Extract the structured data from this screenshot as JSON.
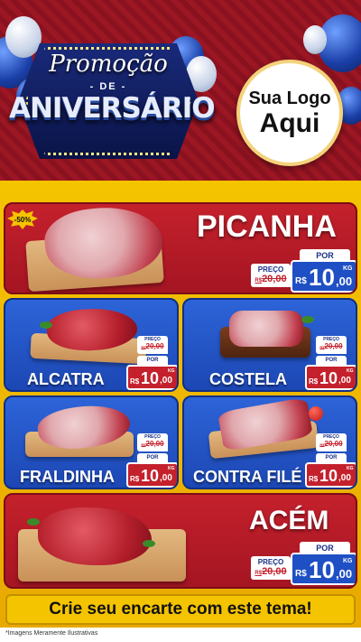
{
  "header": {
    "promo_text": "Promoção",
    "de_text": "- DE -",
    "aniversario_text": "ANIVERSÁRIO",
    "logo_line1": "Sua Logo",
    "logo_line2": "Aqui"
  },
  "products": [
    {
      "name": "PICANHA",
      "discount": "-50%",
      "preco_label": "PREÇO",
      "old_price": "R$20,00",
      "old_currency": "R$",
      "old_value": "20,00",
      "por_label": "POR",
      "currency": "R$",
      "price_int": "10",
      "price_cents": ",00",
      "unit": "KG"
    },
    {
      "name": "ALCATRA",
      "preco_label": "PREÇO",
      "old_currency": "R$",
      "old_value": "20,00",
      "por_label": "POR",
      "currency": "R$",
      "price_int": "10",
      "price_cents": ",00",
      "unit": "KG"
    },
    {
      "name": "COSTELA",
      "preco_label": "PREÇO",
      "old_currency": "R$",
      "old_value": "20,00",
      "por_label": "POR",
      "currency": "R$",
      "price_int": "10",
      "price_cents": ",00",
      "unit": "KG"
    },
    {
      "name": "FRALDINHA",
      "preco_label": "PREÇO",
      "old_currency": "R$",
      "old_value": "20,00",
      "por_label": "POR",
      "currency": "R$",
      "price_int": "10",
      "price_cents": ",00",
      "unit": "KG"
    },
    {
      "name": "CONTRA FILÉ",
      "preco_label": "PREÇO",
      "old_currency": "R$",
      "old_value": "20,00",
      "por_label": "POR",
      "currency": "R$",
      "price_int": "10",
      "price_cents": ",00",
      "unit": "KG"
    },
    {
      "name": "ACÉM",
      "preco_label": "PREÇO",
      "old_currency": "R$",
      "old_value": "20,00",
      "por_label": "POR",
      "currency": "R$",
      "price_int": "10",
      "price_cents": ",00",
      "unit": "KG"
    }
  ],
  "cta_text": "Crie seu encarte com este tema!",
  "footer_note": "*Imagens Meramente Ilustrativas",
  "colors": {
    "red": "#c4212c",
    "blue": "#1f4fc4",
    "yellow": "#f5c400"
  }
}
